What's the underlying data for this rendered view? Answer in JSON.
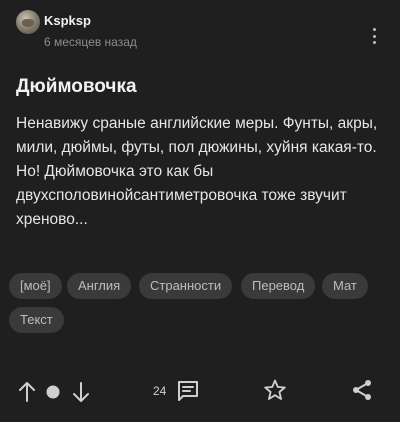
{
  "author": {
    "name": "Kspksp",
    "time": "6 месяцев назад"
  },
  "post": {
    "title": "Дюймовочка",
    "paragraphs": [
      "Ненавижу сраные английские меры. Фунты, акры, мили, дюймы, футы, пол дюжины, хуйня какая-то.",
      "Но! Дюймовочка это как бы двухсполовинойсантиметровочка тоже звучит хреново..."
    ]
  },
  "tags": [
    "[моё]",
    "Англия",
    "Странности",
    "Перевод",
    "Мат",
    "Текст"
  ],
  "actions": {
    "comments_count": "24"
  },
  "colors": {
    "background": "#1f1f1f",
    "tag_background": "#3a3a3a",
    "muted_text": "#8c8c8c"
  },
  "icons": [
    "more-vertical-icon",
    "upvote-arrow-icon",
    "rating-dot-icon",
    "downvote-arrow-icon",
    "comment-icon",
    "star-icon",
    "share-icon"
  ]
}
